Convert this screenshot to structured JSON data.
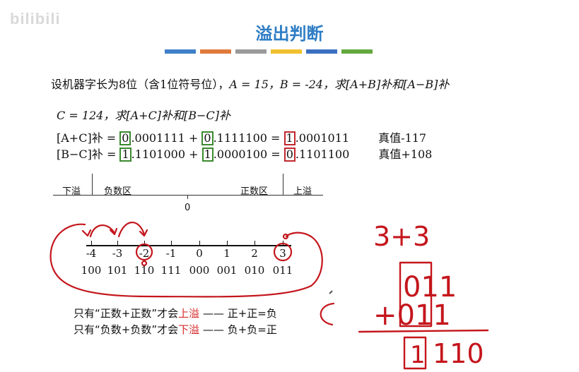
{
  "watermark": "bilibili",
  "title": "溢出判断",
  "title_bar_colors": [
    "#3f80c8",
    "#e07a3c",
    "#9a9a9a",
    "#f0c02f",
    "#3b6fc2",
    "#63a83e"
  ],
  "problem": {
    "line1_prefix": "设机器字长为8位（含1位符号位），",
    "line1_a": "A = 15，",
    "line1_b": "B = -24，求[A+B]补和[A−B]补",
    "line2": "C = 124，求[A+C]补和[B−C]补"
  },
  "calc": {
    "row1": {
      "label": "[A+C]补 =",
      "a_sign": "0",
      "a_rest": ".0001111 +",
      "b_sign": "0",
      "b_rest": ".1111100 =",
      "r_sign": "1",
      "r_rest": ".0001011",
      "truth": "真值-117"
    },
    "row2": {
      "label": "[B−C]补 =",
      "a_sign": "1",
      "a_rest": ".1101000 +",
      "b_sign": "1",
      "b_rest": ".0000100 =",
      "r_sign": "0",
      "r_rest": ".1101100",
      "truth": "真值+108"
    }
  },
  "range": {
    "underflow": "下溢",
    "negative": "负数区",
    "positive": "正数区",
    "overflow": "上溢",
    "zero": "0"
  },
  "numberline": {
    "numbers": [
      "-4",
      "-3",
      "-2",
      "-1",
      "0",
      "1",
      "2",
      "3"
    ],
    "binaries": [
      "100",
      "101",
      "110",
      "111",
      "000",
      "001",
      "010",
      "011"
    ]
  },
  "rules": {
    "line1_a": "只有“正数+正数”才会",
    "line1_b": "上溢",
    "line1_c": "——",
    "line1_d": "正+正=负",
    "line2_a": "只有“负数+负数”才会",
    "line2_b": "下溢",
    "line2_c": "——",
    "line2_d": "负+负=正"
  },
  "handwriting": {
    "top": "3+3",
    "row1": "011",
    "row2": "+011",
    "result": "110",
    "carry": "1"
  }
}
